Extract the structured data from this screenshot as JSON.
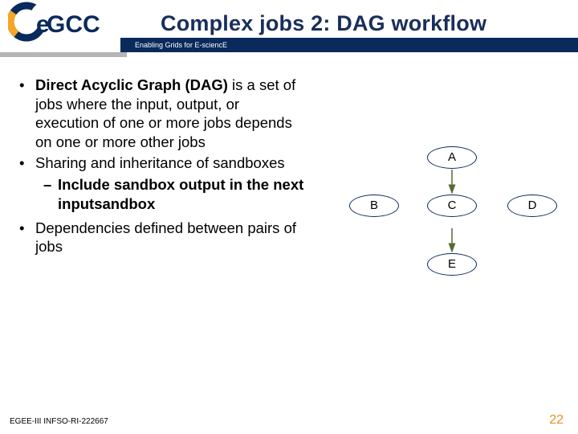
{
  "header": {
    "logo_text": "egee",
    "title": "Complex jobs 2: DAG workflow",
    "subtitle": "Enabling Grids for E-sciencE"
  },
  "bullets": {
    "b1_bold": "Direct Acyclic Graph (DAG)",
    "b1_rest": " is a set of jobs where the input, output, or execution of one or more jobs depends on one or more other jobs",
    "b2": "Sharing and inheritance of sandboxes",
    "b2_sub": "Include sandbox output in the next inputsandbox",
    "b3": "Dependencies defined between pairs of jobs"
  },
  "diagram": {
    "nodes": [
      "A",
      "B",
      "C",
      "D",
      "E"
    ]
  },
  "footer": {
    "ref": "EGEE-III INFSO-RI-222667",
    "page": "22"
  }
}
